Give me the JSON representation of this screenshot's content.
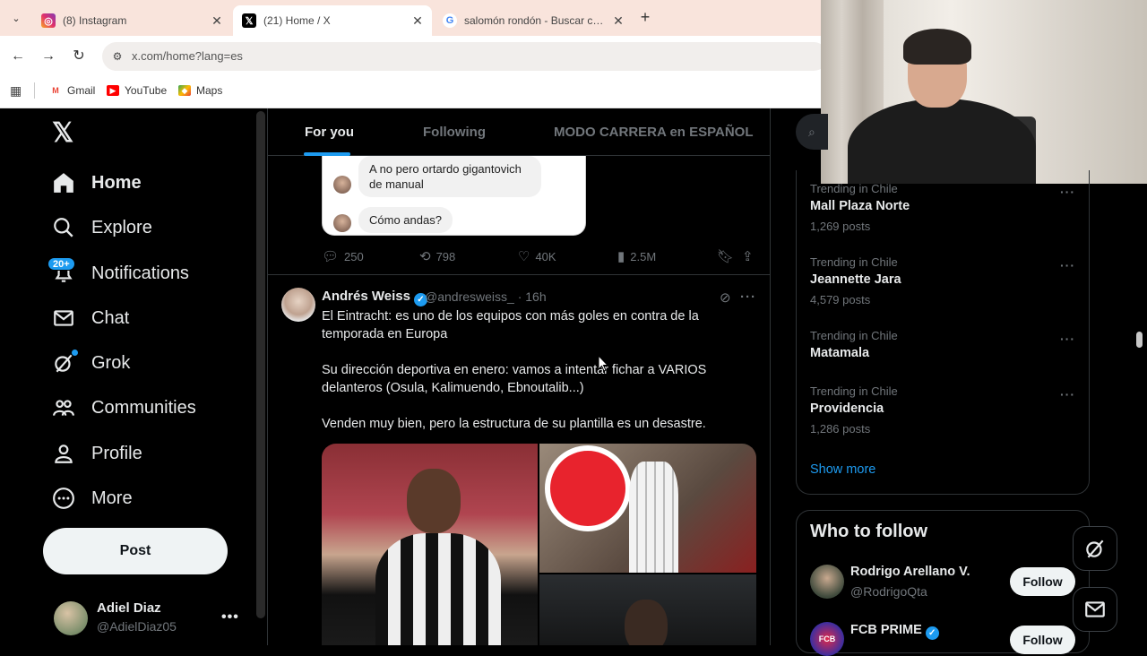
{
  "browser": {
    "tabs": [
      {
        "title": "(8) Instagram",
        "favicon": "instagram-icon"
      },
      {
        "title": "(21) Home / X",
        "favicon": "x-icon",
        "active": true
      },
      {
        "title": "salomón rondón - Buscar con G",
        "favicon": "google-icon"
      }
    ],
    "url": "x.com/home?lang=es",
    "bookmarks": [
      {
        "label": "Gmail"
      },
      {
        "label": "YouTube"
      },
      {
        "label": "Maps"
      }
    ]
  },
  "sidebar": {
    "items": [
      {
        "label": "Home",
        "icon": "home-icon"
      },
      {
        "label": "Explore",
        "icon": "search-icon"
      },
      {
        "label": "Notifications",
        "icon": "bell-icon"
      },
      {
        "label": "Chat",
        "icon": "mail-icon"
      },
      {
        "label": "Grok",
        "icon": "grok-icon"
      },
      {
        "label": "Communities",
        "icon": "communities-icon"
      },
      {
        "label": "Profile",
        "icon": "person-icon"
      },
      {
        "label": "More",
        "icon": "more-circle-icon"
      }
    ],
    "notifications_badge": "20+",
    "post_label": "Post",
    "account": {
      "name": "Adiel Diaz",
      "handle": "@AdielDiaz05"
    }
  },
  "feed": {
    "tabs": [
      "For you",
      "Following",
      "MODO CARRERA en ESPAÑOL"
    ],
    "prev_post": {
      "bubbles": [
        "A no pero ortardo gigantovich de manual",
        "Cómo andas?"
      ],
      "replies": "250",
      "reposts": "798",
      "likes": "40K",
      "views": "2.5M"
    },
    "post": {
      "name": "Andrés Weiss",
      "handle": "@andresweiss_",
      "time": "· 16h",
      "text1": "El Eintracht: es uno de los equipos con más goles en contra de la temporada en Europa",
      "text2": "Su dirección deportiva en enero: vamos a intentar fichar a VARIOS delanteros (Osula, Kalimuendo, Ebnoutalib...)",
      "text3": "Venden muy bien, pero la estructura de su plantilla es un desastre."
    }
  },
  "trends": [
    {
      "category": "Trending in Chile",
      "title": "Mall Plaza Norte",
      "count": "1,269 posts"
    },
    {
      "category": "Trending in Chile",
      "title": "Jeannette Jara",
      "count": "4,579 posts"
    },
    {
      "category": "Trending in Chile",
      "title": "Matamala",
      "count": ""
    },
    {
      "category": "Trending in Chile",
      "title": "Providencia",
      "count": "1,286 posts"
    }
  ],
  "show_more": "Show more",
  "who_to_follow": {
    "title": "Who to follow",
    "accounts": [
      {
        "name": "Rodrigo Arellano V.",
        "handle": "@RodrigoQta",
        "button": "Follow"
      },
      {
        "name": "FCB PRIME",
        "handle": "",
        "button": "Follow"
      }
    ]
  },
  "colors": {
    "accent": "#1d9bf0",
    "background": "#000000",
    "text": "#e7e9ea",
    "muted": "#71767b"
  }
}
